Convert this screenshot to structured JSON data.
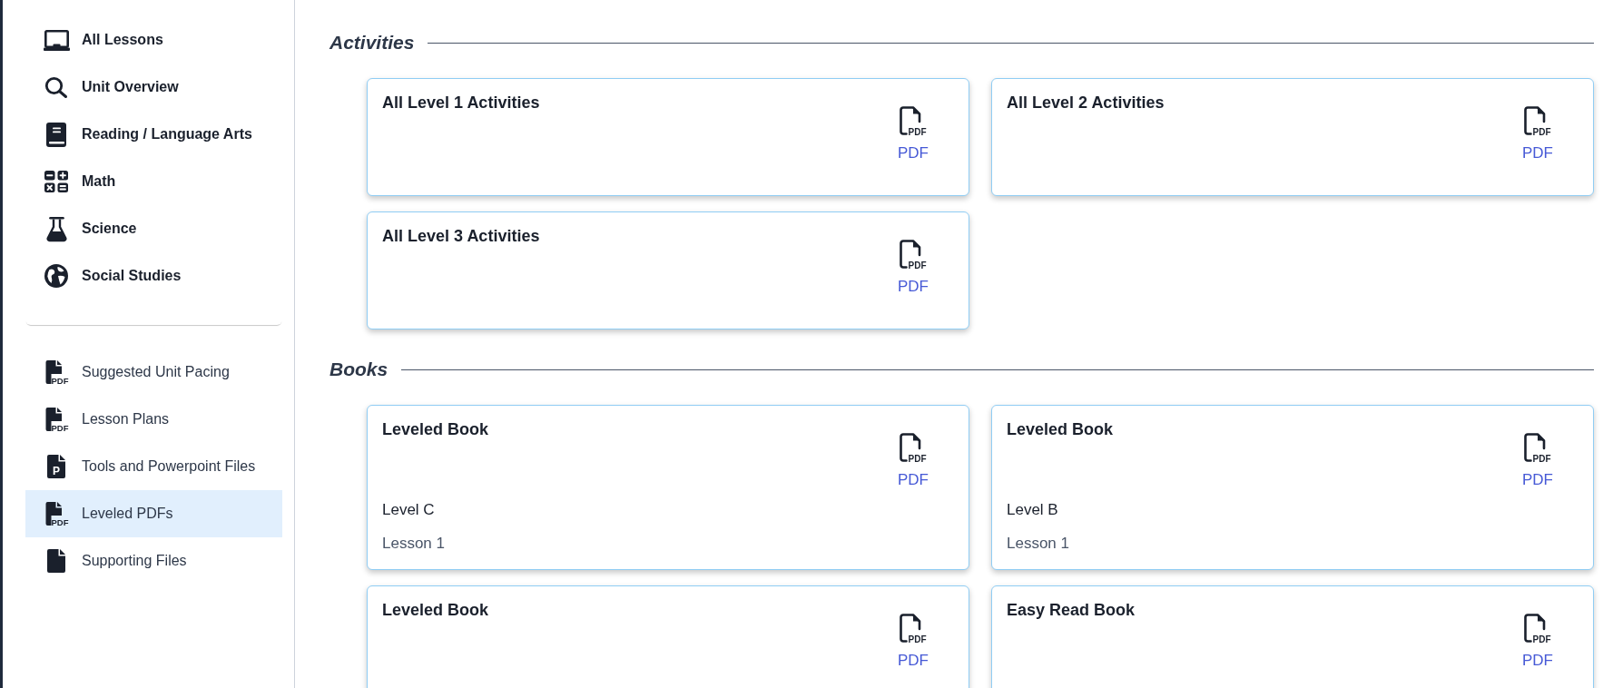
{
  "sidebar": {
    "subjects": [
      {
        "label": "All Lessons",
        "kind": "lessons",
        "selected": false
      },
      {
        "label": "Unit Overview",
        "kind": "overview",
        "selected": false
      },
      {
        "label": "Reading / Language Arts",
        "kind": "reading",
        "selected": false
      },
      {
        "label": "Math",
        "kind": "math",
        "selected": false
      },
      {
        "label": "Science",
        "kind": "science",
        "selected": false
      },
      {
        "label": "Social Studies",
        "kind": "social",
        "selected": false
      }
    ],
    "files": [
      {
        "label": "Suggested Unit Pacing",
        "kind": "pdf",
        "icon_text": "PDF",
        "selected": false
      },
      {
        "label": "Lesson Plans",
        "kind": "pdf",
        "icon_text": "PDF",
        "selected": false
      },
      {
        "label": "Tools and Powerpoint Files",
        "kind": "slides",
        "icon_text": "P",
        "selected": false
      },
      {
        "label": "Leveled PDFs",
        "kind": "pdf",
        "icon_text": "PDF",
        "selected": true
      },
      {
        "label": "Supporting Files",
        "kind": "file",
        "selected": false
      }
    ]
  },
  "sections": [
    {
      "title": "Activities",
      "cards": [
        {
          "title": "All Level 1 Activities",
          "icon_text": "PDF",
          "link": "PDF"
        },
        {
          "title": "All Level 2 Activities",
          "icon_text": "PDF",
          "link": "PDF"
        },
        {
          "title": "All Level 3 Activities",
          "icon_text": "PDF",
          "link": "PDF"
        }
      ]
    },
    {
      "title": "Books",
      "cards": [
        {
          "title": "Leveled Book",
          "icon_text": "PDF",
          "link": "PDF",
          "reading_level": "Level C",
          "lesson": "Lesson 1"
        },
        {
          "title": "Leveled Book",
          "icon_text": "PDF",
          "link": "PDF",
          "reading_level": "Level B",
          "lesson": "Lesson 1"
        },
        {
          "title": "Leveled Book",
          "icon_text": "PDF",
          "link": "PDF"
        },
        {
          "title": "Easy Read Book",
          "icon_text": "PDF",
          "link": "PDF"
        }
      ]
    }
  ]
}
